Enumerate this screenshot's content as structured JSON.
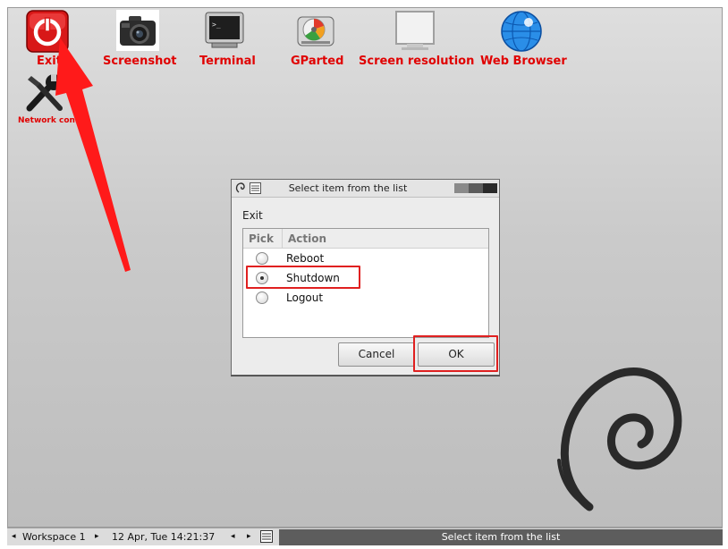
{
  "desktop": {
    "icons": [
      {
        "name": "exit-icon",
        "label": "Exit"
      },
      {
        "name": "screenshot-icon",
        "label": "Screenshot"
      },
      {
        "name": "terminal-icon",
        "label": "Terminal"
      },
      {
        "name": "gparted-icon",
        "label": "GParted"
      },
      {
        "name": "screen-resolution-icon",
        "label": "Screen resolution"
      },
      {
        "name": "web-browser-icon",
        "label": "Web Browser"
      },
      {
        "name": "network-config-icon",
        "label": "Network config"
      }
    ],
    "label_color": "#e00000"
  },
  "dialog": {
    "title": "Select item from the list",
    "prompt": "Exit",
    "columns": [
      "Pick",
      "Action"
    ],
    "items": [
      {
        "label": "Reboot",
        "selected": false
      },
      {
        "label": "Shutdown",
        "selected": true
      },
      {
        "label": "Logout",
        "selected": false
      }
    ],
    "cancel_label": "Cancel",
    "ok_label": "OK"
  },
  "taskbar": {
    "workspace": "Workspace 1",
    "datetime": "12 Apr, Tue 14:21:37",
    "task_title": "Select item from the list"
  },
  "annotation_color": "#ff1a1a"
}
